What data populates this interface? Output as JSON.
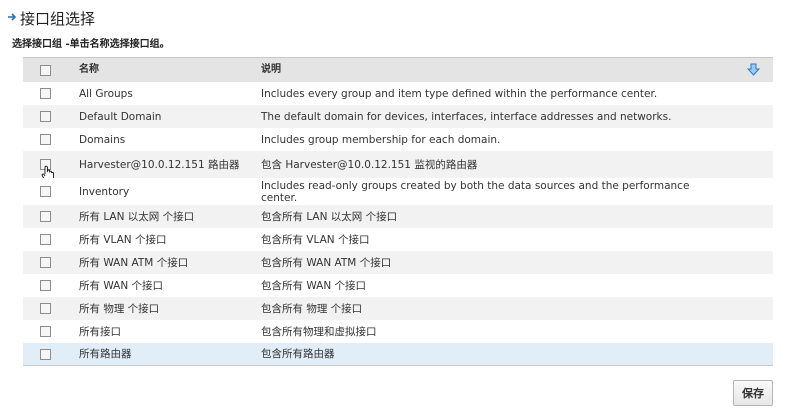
{
  "page": {
    "title": "接口组选择",
    "subtitle": "选择接口组 -单击名称选择接口组。"
  },
  "table": {
    "headers": {
      "name": "名称",
      "description": "说明"
    },
    "rows": [
      {
        "name": "All Groups",
        "description": "Includes every group and item type defined within the performance center."
      },
      {
        "name": "Default Domain",
        "description": "The default domain for devices, interfaces, interface addresses and networks."
      },
      {
        "name": "Domains",
        "description": "Includes group membership for each domain."
      },
      {
        "name": "Harvester@10.0.12.151 路由器",
        "description": "包含 Harvester@10.0.12.151 监视的路由器"
      },
      {
        "name": "Inventory",
        "description": "Includes read-only groups created by both the data sources and the performance center."
      },
      {
        "name": "所有 LAN 以太网 个接口",
        "description": "包含所有 LAN 以太网 个接口"
      },
      {
        "name": "所有 VLAN 个接口",
        "description": "包含所有 VLAN 个接口"
      },
      {
        "name": "所有 WAN ATM 个接口",
        "description": "包含所有 WAN ATM 个接口"
      },
      {
        "name": "所有 WAN 个接口",
        "description": "包含所有 WAN 个接口"
      },
      {
        "name": "所有 物理 个接口",
        "description": "包含所有 物理 个接口"
      },
      {
        "name": "所有接口",
        "description": "包含所有物理和虚拟接口"
      },
      {
        "name": "所有路由器",
        "description": "包含所有路由器"
      }
    ]
  },
  "buttons": {
    "save": "保存"
  },
  "colors": {
    "accent": "#2a6fb0",
    "header_bg": "#e4e4e4",
    "stripe_bg": "#f2f2f2",
    "selected_bg": "#e1edf7"
  },
  "icons": {
    "title": "arrow-right-icon",
    "sort": "arrow-down-icon",
    "cursor": "hand-pointer-icon"
  }
}
